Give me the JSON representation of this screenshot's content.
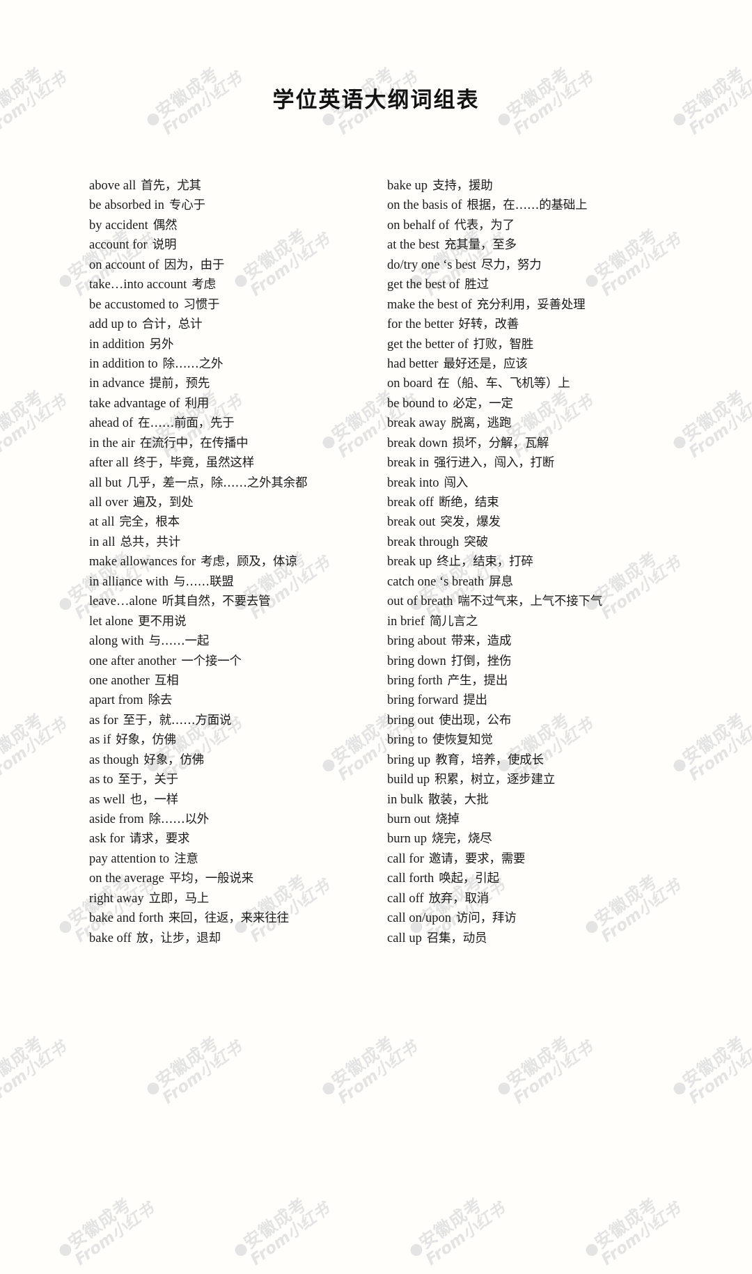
{
  "document": {
    "title": "学位英语大纲词组表",
    "background_color": "#fffefb",
    "text_color": "#1b1b1b"
  },
  "watermark": {
    "line1": "@安徽成考",
    "line2": "From小红书",
    "color": "#e4e4e4",
    "rotation_deg": -36
  },
  "columns": [
    {
      "id": "left",
      "entries": [
        {
          "term": "above all",
          "gloss": "首先，尤其"
        },
        {
          "term": "be absorbed in",
          "gloss": "专心于"
        },
        {
          "term": "by accident",
          "gloss": "偶然"
        },
        {
          "term": "account for",
          "gloss": "说明"
        },
        {
          "term": "on account of",
          "gloss": "因为，由于"
        },
        {
          "term": "take…into account",
          "gloss": "考虑"
        },
        {
          "term": "be accustomed to",
          "gloss": "习惯于"
        },
        {
          "term": "add up to",
          "gloss": "合计，总计"
        },
        {
          "term": "in addition",
          "gloss": "另外"
        },
        {
          "term": "in addition to",
          "gloss": "除……之外"
        },
        {
          "term": "in advance",
          "gloss": "提前，预先"
        },
        {
          "term": "take advantage of",
          "gloss": "利用"
        },
        {
          "term": "ahead of",
          "gloss": "在……前面，先于"
        },
        {
          "term": "in the air",
          "gloss": "在流行中，在传播中"
        },
        {
          "term": "after all",
          "gloss": "终于，毕竟，虽然这样"
        },
        {
          "term": "all but",
          "gloss": "几乎，差一点，除……之外其余都"
        },
        {
          "term": "all over",
          "gloss": "遍及，到处"
        },
        {
          "term": "at all",
          "gloss": "完全，根本"
        },
        {
          "term": "in all",
          "gloss": "总共，共计"
        },
        {
          "term": "make allowances for",
          "gloss": "考虑，顾及，体谅"
        },
        {
          "term": "in alliance with",
          "gloss": "与……联盟"
        },
        {
          "term": "leave…alone",
          "gloss": "听其自然，不要去管"
        },
        {
          "term": "let alone",
          "gloss": "更不用说"
        },
        {
          "term": "along with",
          "gloss": "与……一起"
        },
        {
          "term": "one after another",
          "gloss": "一个接一个"
        },
        {
          "term": "one another",
          "gloss": "互相"
        },
        {
          "term": "apart from",
          "gloss": "除去"
        },
        {
          "term": "as for",
          "gloss": "至于，就……方面说"
        },
        {
          "term": "as if",
          "gloss": "好象，仿佛"
        },
        {
          "term": "as though",
          "gloss": "好象，仿佛"
        },
        {
          "term": "as to",
          "gloss": "至于，关于"
        },
        {
          "term": "as well",
          "gloss": "也，一样"
        },
        {
          "term": "aside from",
          "gloss": "除……以外"
        },
        {
          "term": "ask for",
          "gloss": "请求，要求"
        },
        {
          "term": "pay attention to",
          "gloss": "注意"
        },
        {
          "term": "on the average",
          "gloss": "平均，一般说来"
        },
        {
          "term": "right away",
          "gloss": "立即，马上"
        },
        {
          "term": "bake and forth",
          "gloss": "来回，往返，来来往往"
        },
        {
          "term": "bake off",
          "gloss": "放，让步，退却"
        }
      ]
    },
    {
      "id": "right",
      "entries": [
        {
          "term": "bake up",
          "gloss": "支持，援助"
        },
        {
          "term": "on the basis of",
          "gloss": "根据，在……的基础上"
        },
        {
          "term": "on behalf of",
          "gloss": "代表，为了"
        },
        {
          "term": "at the best",
          "gloss": "充其量，至多"
        },
        {
          "term": "do/try one ‘s best",
          "gloss": "尽力，努力"
        },
        {
          "term": "get the best of",
          "gloss": "胜过"
        },
        {
          "term": "make the best of",
          "gloss": "充分利用，妥善处理"
        },
        {
          "term": "for the better",
          "gloss": "好转，改善"
        },
        {
          "term": "get the better of",
          "gloss": "打败，智胜"
        },
        {
          "term": "had better",
          "gloss": "最好还是，应该"
        },
        {
          "term": "on board",
          "gloss": "在（船、车、飞机等）上"
        },
        {
          "term": "be bound to",
          "gloss": "必定，一定"
        },
        {
          "term": "break away",
          "gloss": "脱离，逃跑"
        },
        {
          "term": "break down",
          "gloss": "损坏，分解，瓦解"
        },
        {
          "term": "break in",
          "gloss": "强行进入，闯入，打断"
        },
        {
          "term": "break into",
          "gloss": "闯入"
        },
        {
          "term": "break off",
          "gloss": "断绝，结束"
        },
        {
          "term": "break out",
          "gloss": "突发，爆发"
        },
        {
          "term": "break through",
          "gloss": "突破"
        },
        {
          "term": "break up",
          "gloss": "终止，结束，打碎"
        },
        {
          "term": "catch one ‘s breath",
          "gloss": "屏息"
        },
        {
          "term": "out of breath",
          "gloss": "喘不过气来，上气不接下气"
        },
        {
          "term": "in brief",
          "gloss": "简儿言之"
        },
        {
          "term": "bring about",
          "gloss": "带来，造成"
        },
        {
          "term": "bring down",
          "gloss": "打倒，挫伤"
        },
        {
          "term": "bring forth",
          "gloss": "产生，提出"
        },
        {
          "term": "bring forward",
          "gloss": "提出"
        },
        {
          "term": "bring out",
          "gloss": "使出现，公布"
        },
        {
          "term": "bring to",
          "gloss": "使恢复知觉"
        },
        {
          "term": "bring up",
          "gloss": "教育，培养，使成长"
        },
        {
          "term": "build up",
          "gloss": "积累，树立，逐步建立"
        },
        {
          "term": "in bulk",
          "gloss": "散装，大批"
        },
        {
          "term": "burn out",
          "gloss": "烧掉"
        },
        {
          "term": "burn up",
          "gloss": "烧完，烧尽"
        },
        {
          "term": "call for",
          "gloss": "邀请，要求，需要"
        },
        {
          "term": "call forth",
          "gloss": "唤起，引起"
        },
        {
          "term": "call off",
          "gloss": "放弃，取消"
        },
        {
          "term": "call on/upon",
          "gloss": "访问，拜访"
        },
        {
          "term": "call up",
          "gloss": "召集，动员"
        }
      ]
    }
  ]
}
